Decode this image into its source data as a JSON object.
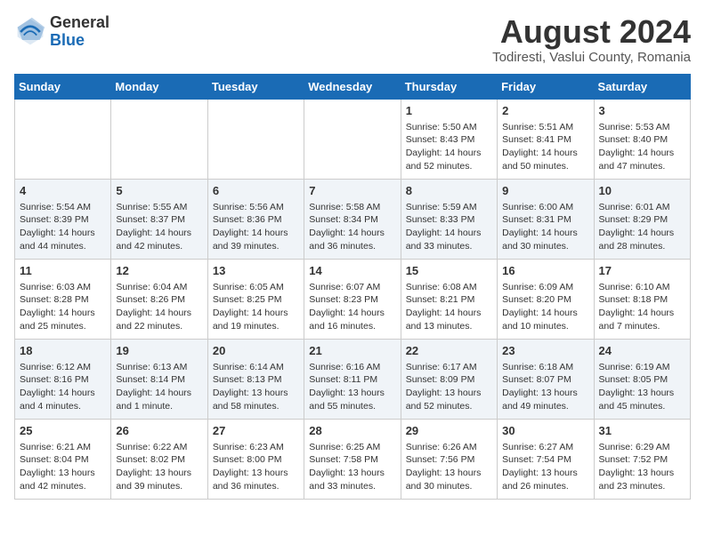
{
  "header": {
    "logo_general": "General",
    "logo_blue": "Blue",
    "title": "August 2024",
    "subtitle": "Todiresti, Vaslui County, Romania"
  },
  "days_of_week": [
    "Sunday",
    "Monday",
    "Tuesday",
    "Wednesday",
    "Thursday",
    "Friday",
    "Saturday"
  ],
  "weeks": [
    [
      {
        "day": "",
        "info": ""
      },
      {
        "day": "",
        "info": ""
      },
      {
        "day": "",
        "info": ""
      },
      {
        "day": "",
        "info": ""
      },
      {
        "day": "1",
        "info": "Sunrise: 5:50 AM\nSunset: 8:43 PM\nDaylight: 14 hours and 52 minutes."
      },
      {
        "day": "2",
        "info": "Sunrise: 5:51 AM\nSunset: 8:41 PM\nDaylight: 14 hours and 50 minutes."
      },
      {
        "day": "3",
        "info": "Sunrise: 5:53 AM\nSunset: 8:40 PM\nDaylight: 14 hours and 47 minutes."
      }
    ],
    [
      {
        "day": "4",
        "info": "Sunrise: 5:54 AM\nSunset: 8:39 PM\nDaylight: 14 hours and 44 minutes."
      },
      {
        "day": "5",
        "info": "Sunrise: 5:55 AM\nSunset: 8:37 PM\nDaylight: 14 hours and 42 minutes."
      },
      {
        "day": "6",
        "info": "Sunrise: 5:56 AM\nSunset: 8:36 PM\nDaylight: 14 hours and 39 minutes."
      },
      {
        "day": "7",
        "info": "Sunrise: 5:58 AM\nSunset: 8:34 PM\nDaylight: 14 hours and 36 minutes."
      },
      {
        "day": "8",
        "info": "Sunrise: 5:59 AM\nSunset: 8:33 PM\nDaylight: 14 hours and 33 minutes."
      },
      {
        "day": "9",
        "info": "Sunrise: 6:00 AM\nSunset: 8:31 PM\nDaylight: 14 hours and 30 minutes."
      },
      {
        "day": "10",
        "info": "Sunrise: 6:01 AM\nSunset: 8:29 PM\nDaylight: 14 hours and 28 minutes."
      }
    ],
    [
      {
        "day": "11",
        "info": "Sunrise: 6:03 AM\nSunset: 8:28 PM\nDaylight: 14 hours and 25 minutes."
      },
      {
        "day": "12",
        "info": "Sunrise: 6:04 AM\nSunset: 8:26 PM\nDaylight: 14 hours and 22 minutes."
      },
      {
        "day": "13",
        "info": "Sunrise: 6:05 AM\nSunset: 8:25 PM\nDaylight: 14 hours and 19 minutes."
      },
      {
        "day": "14",
        "info": "Sunrise: 6:07 AM\nSunset: 8:23 PM\nDaylight: 14 hours and 16 minutes."
      },
      {
        "day": "15",
        "info": "Sunrise: 6:08 AM\nSunset: 8:21 PM\nDaylight: 14 hours and 13 minutes."
      },
      {
        "day": "16",
        "info": "Sunrise: 6:09 AM\nSunset: 8:20 PM\nDaylight: 14 hours and 10 minutes."
      },
      {
        "day": "17",
        "info": "Sunrise: 6:10 AM\nSunset: 8:18 PM\nDaylight: 14 hours and 7 minutes."
      }
    ],
    [
      {
        "day": "18",
        "info": "Sunrise: 6:12 AM\nSunset: 8:16 PM\nDaylight: 14 hours and 4 minutes."
      },
      {
        "day": "19",
        "info": "Sunrise: 6:13 AM\nSunset: 8:14 PM\nDaylight: 14 hours and 1 minute."
      },
      {
        "day": "20",
        "info": "Sunrise: 6:14 AM\nSunset: 8:13 PM\nDaylight: 13 hours and 58 minutes."
      },
      {
        "day": "21",
        "info": "Sunrise: 6:16 AM\nSunset: 8:11 PM\nDaylight: 13 hours and 55 minutes."
      },
      {
        "day": "22",
        "info": "Sunrise: 6:17 AM\nSunset: 8:09 PM\nDaylight: 13 hours and 52 minutes."
      },
      {
        "day": "23",
        "info": "Sunrise: 6:18 AM\nSunset: 8:07 PM\nDaylight: 13 hours and 49 minutes."
      },
      {
        "day": "24",
        "info": "Sunrise: 6:19 AM\nSunset: 8:05 PM\nDaylight: 13 hours and 45 minutes."
      }
    ],
    [
      {
        "day": "25",
        "info": "Sunrise: 6:21 AM\nSunset: 8:04 PM\nDaylight: 13 hours and 42 minutes."
      },
      {
        "day": "26",
        "info": "Sunrise: 6:22 AM\nSunset: 8:02 PM\nDaylight: 13 hours and 39 minutes."
      },
      {
        "day": "27",
        "info": "Sunrise: 6:23 AM\nSunset: 8:00 PM\nDaylight: 13 hours and 36 minutes."
      },
      {
        "day": "28",
        "info": "Sunrise: 6:25 AM\nSunset: 7:58 PM\nDaylight: 13 hours and 33 minutes."
      },
      {
        "day": "29",
        "info": "Sunrise: 6:26 AM\nSunset: 7:56 PM\nDaylight: 13 hours and 30 minutes."
      },
      {
        "day": "30",
        "info": "Sunrise: 6:27 AM\nSunset: 7:54 PM\nDaylight: 13 hours and 26 minutes."
      },
      {
        "day": "31",
        "info": "Sunrise: 6:29 AM\nSunset: 7:52 PM\nDaylight: 13 hours and 23 minutes."
      }
    ]
  ]
}
